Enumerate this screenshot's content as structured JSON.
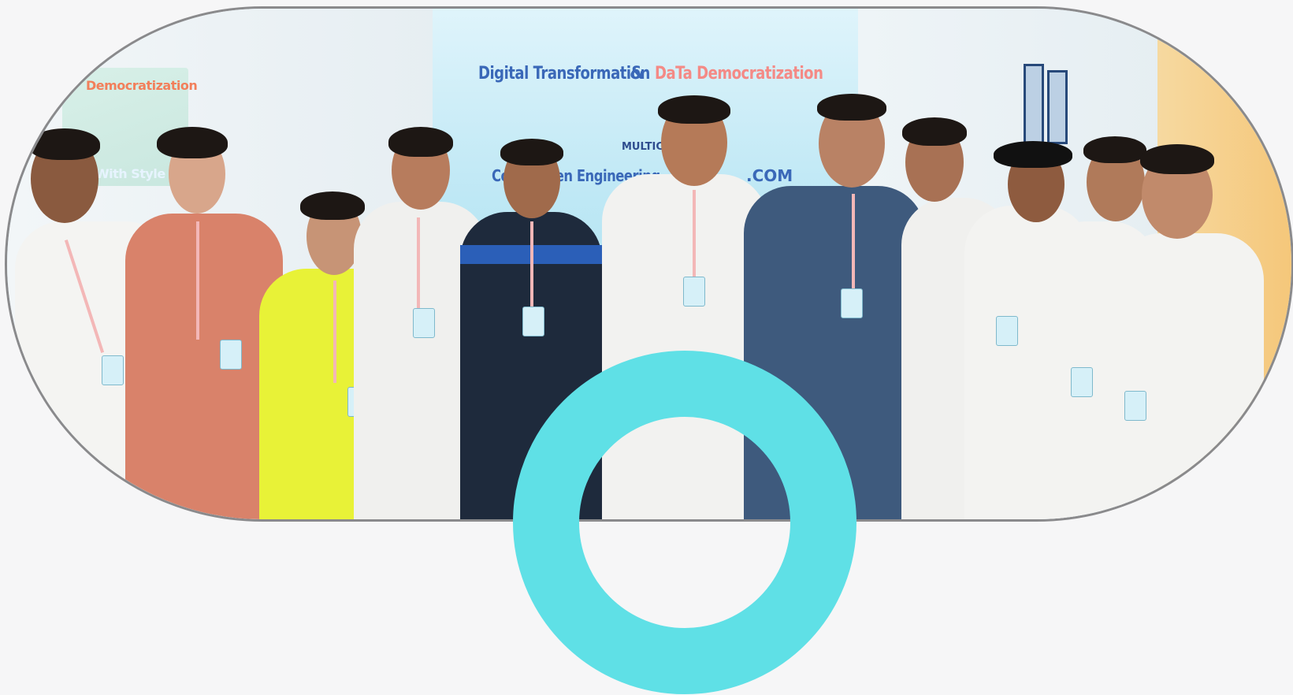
{
  "photo": {
    "poster": {
      "left_heading": "Democratization",
      "left_subline": "With Style",
      "title_part1": "Digital Transformation",
      "title_ampersand": "&",
      "title_part2": "DaTa Democratization",
      "logo_text": "MULTICLOUD",
      "subtitle": "Co... Driven Engineering...",
      "subtitle_suffix": ".COM"
    }
  },
  "colors": {
    "ring": "#5fe0e6",
    "frame_border": "#8a8a8c",
    "background": "#f6f6f7"
  },
  "icons": {
    "decorative_ring": "ring-icon"
  }
}
